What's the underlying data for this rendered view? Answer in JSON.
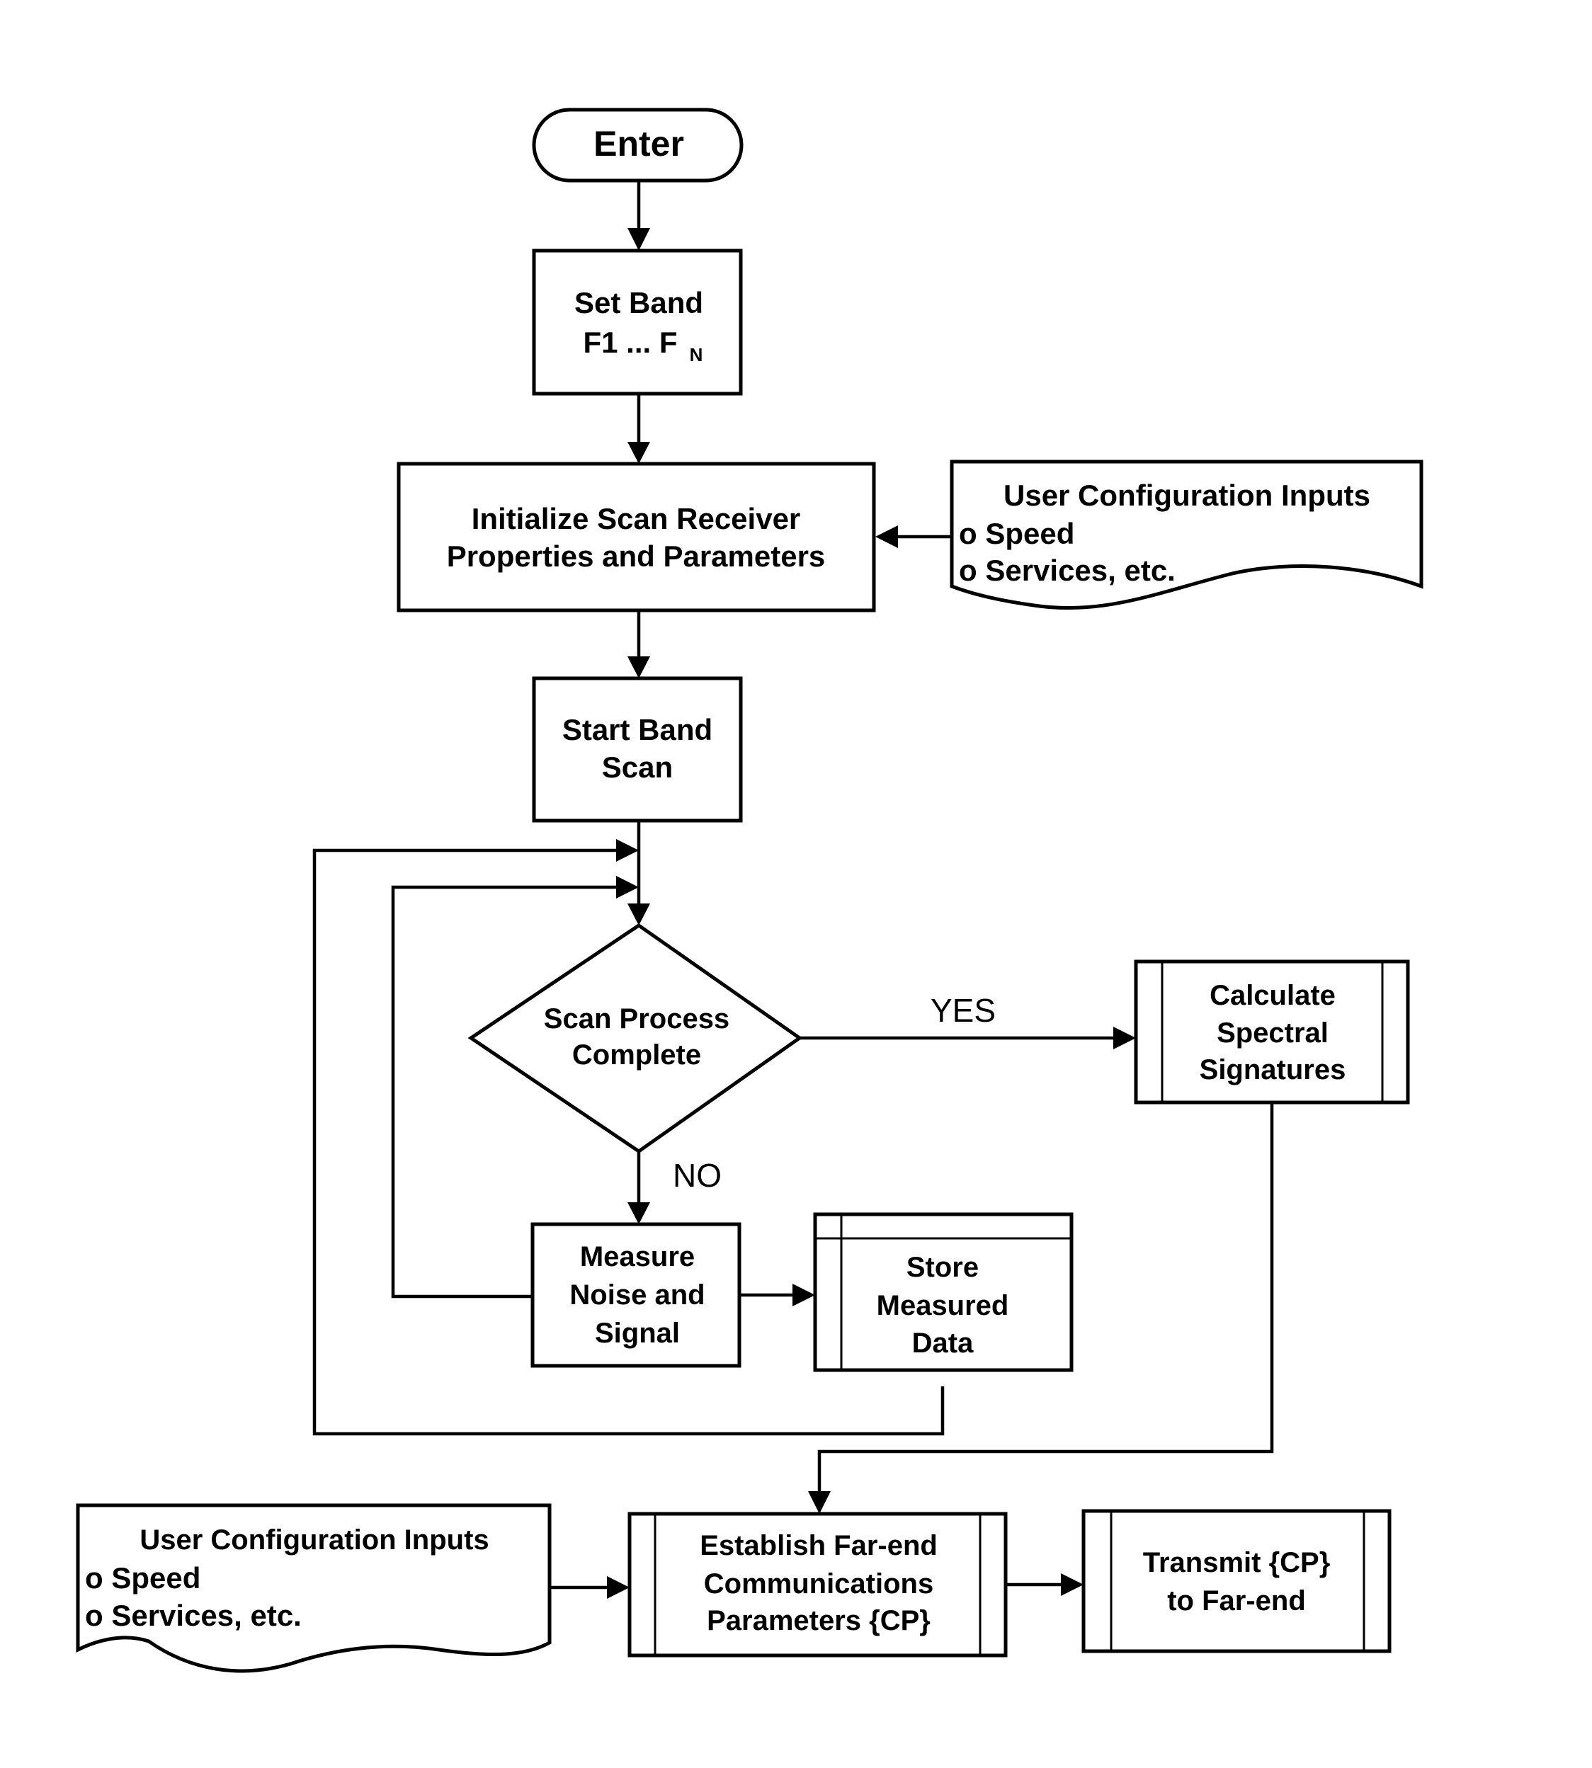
{
  "diagram": {
    "type": "flowchart",
    "nodes": {
      "enter": {
        "label": "Enter"
      },
      "set_band": {
        "line1": "Set Band",
        "line2_main": "F1 ... F",
        "line2_sub": "N"
      },
      "init_scan": {
        "line1": "Initialize Scan Receiver",
        "line2": "Properties and Parameters"
      },
      "user_config_top": {
        "title": "User Configuration Inputs",
        "items": [
          "o Speed",
          "o Services, etc."
        ]
      },
      "start_band_scan": {
        "line1": "Start Band",
        "line2": "Scan"
      },
      "scan_complete": {
        "line1": "Scan Process",
        "line2": "Complete"
      },
      "calc_signatures": {
        "line1": "Calculate",
        "line2": "Spectral",
        "line3": "Signatures"
      },
      "measure": {
        "line1": "Measure",
        "line2": "Noise and",
        "line3": "Signal"
      },
      "store": {
        "line1": "Store",
        "line2": "Measured",
        "line3": "Data"
      },
      "user_config_bottom": {
        "title": "User Configuration Inputs",
        "items": [
          "o Speed",
          "o Services, etc."
        ]
      },
      "establish": {
        "line1": "Establish Far-end",
        "line2": "Communications",
        "line3": "Parameters {CP}"
      },
      "transmit": {
        "line1": "Transmit {CP}",
        "line2": "to Far-end"
      }
    },
    "edge_labels": {
      "yes": "YES",
      "no": "NO"
    },
    "edges": [
      [
        "enter",
        "set_band"
      ],
      [
        "set_band",
        "init_scan"
      ],
      [
        "user_config_top",
        "init_scan"
      ],
      [
        "init_scan",
        "start_band_scan"
      ],
      [
        "start_band_scan",
        "scan_complete"
      ],
      [
        "scan_complete",
        "calc_signatures",
        "YES"
      ],
      [
        "scan_complete",
        "measure",
        "NO"
      ],
      [
        "measure",
        "store"
      ],
      [
        "measure",
        "scan_complete",
        "loop"
      ],
      [
        "store",
        "scan_complete",
        "loop"
      ],
      [
        "calc_signatures",
        "establish"
      ],
      [
        "user_config_bottom",
        "establish"
      ],
      [
        "establish",
        "transmit"
      ]
    ]
  }
}
